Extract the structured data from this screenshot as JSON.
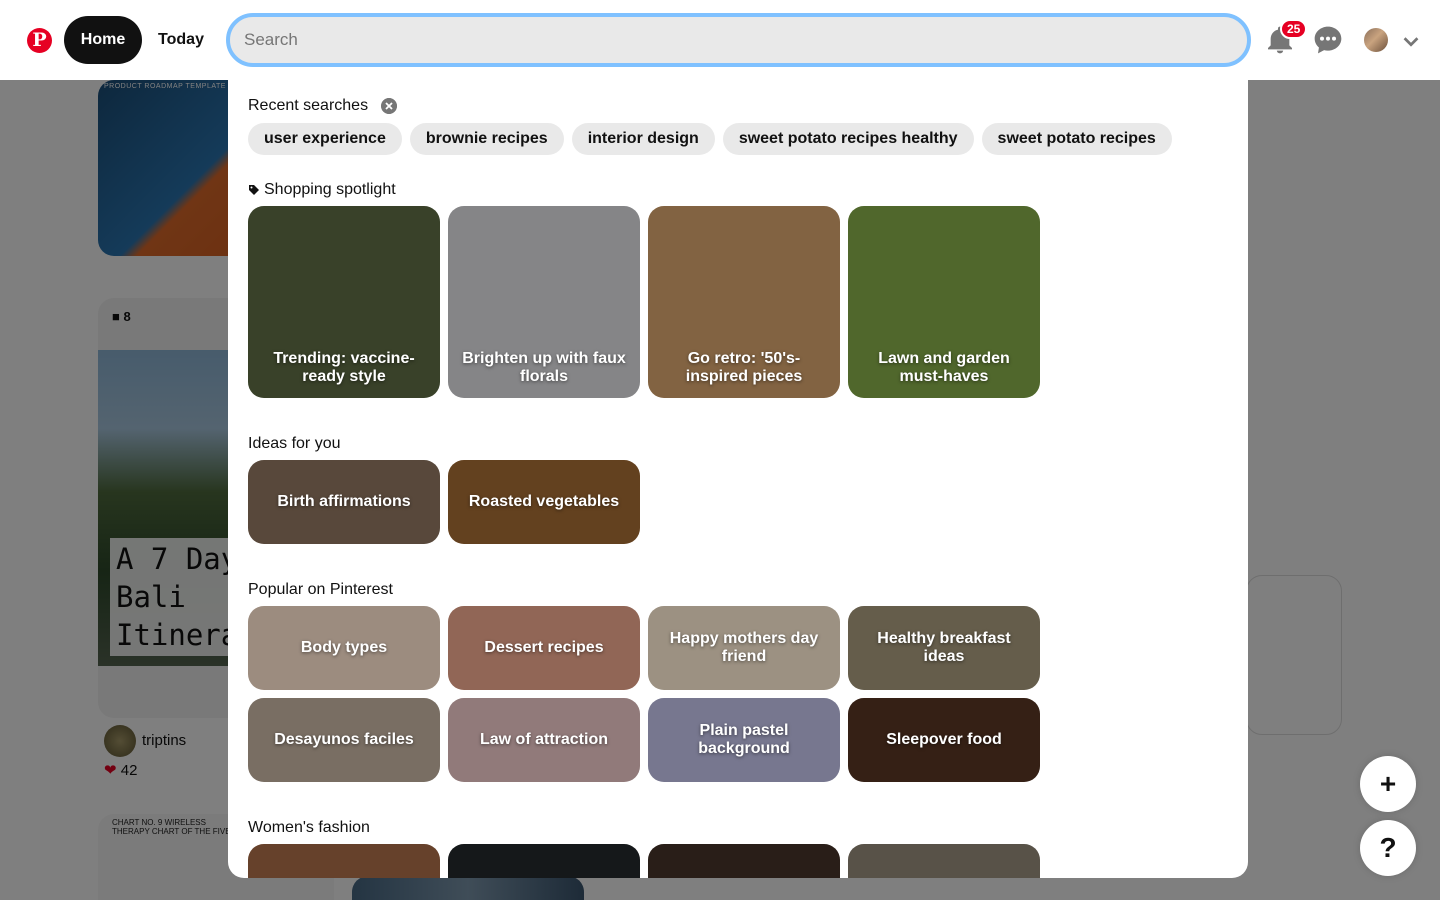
{
  "header": {
    "logo_letter": "P",
    "nav": {
      "home_label": "Home",
      "today_label": "Today"
    },
    "search": {
      "placeholder": "Search",
      "value": ""
    },
    "notifications": {
      "count": "25"
    },
    "icons": [
      "pinterest-logo-icon",
      "bell-icon",
      "chat-bubble-icon",
      "chevron-down-icon"
    ]
  },
  "feed": {
    "roadmap_title": "PRODUCT ROADMAP TEMPLATE",
    "board_count": "8",
    "bali_title": "A 7 Day\nBali\nItinera",
    "bali_user": "triptins",
    "bali_likes": "42",
    "chart_caption": "CHART NO. 9 WIRELESS\nTHERAPY CHART OF THE FIVE E"
  },
  "search_panel": {
    "recent": {
      "title": "Recent searches",
      "items": [
        "user experience",
        "brownie recipes",
        "interior design",
        "sweet potato recipes healthy",
        "sweet potato recipes"
      ]
    },
    "shopping": {
      "title": "Shopping spotlight",
      "tiles": [
        {
          "label": "Trending: vaccine-ready style",
          "bg": "#4f5a3a"
        },
        {
          "label": "Brighten up with faux florals",
          "bg": "#b9b9bc"
        },
        {
          "label": "Go retro: '50's-inspired pieces",
          "bg": "#b58a5c"
        },
        {
          "label": "Lawn and garden must-haves",
          "bg": "#6f8f3d"
        }
      ]
    },
    "ideas": {
      "title": "Ideas for you",
      "tiles": [
        {
          "label": "Birth affirmations",
          "bg": "#7a6552"
        },
        {
          "label": "Roasted vegetables",
          "bg": "#8a5a2b"
        }
      ]
    },
    "popular": {
      "title": "Popular on Pinterest",
      "tiles": [
        {
          "label": "Body types",
          "bg": "#d9c2b0"
        },
        {
          "label": "Dessert recipes",
          "bg": "#c98e78"
        },
        {
          "label": "Happy mothers day friend",
          "bg": "#d8c9b4"
        },
        {
          "label": "Healthy breakfast ideas",
          "bg": "#8c8168"
        },
        {
          "label": "Desayunos faciles",
          "bg": "#a8998a"
        },
        {
          "label": "Law of attraction",
          "bg": "#c9a9a9"
        },
        {
          "label": "Plain pastel background",
          "bg": "#a5a6c6"
        },
        {
          "label": "Sleepover food",
          "bg": "#4a2d1e"
        }
      ]
    },
    "fashion": {
      "title": "Women's fashion",
      "tiles": [
        {
          "bg": "#8e5a3c"
        },
        {
          "bg": "#1e2224"
        },
        {
          "bg": "#3a2a22"
        },
        {
          "bg": "#7a7265"
        }
      ]
    }
  },
  "fab": {
    "add_label": "+",
    "help_label": "?"
  }
}
